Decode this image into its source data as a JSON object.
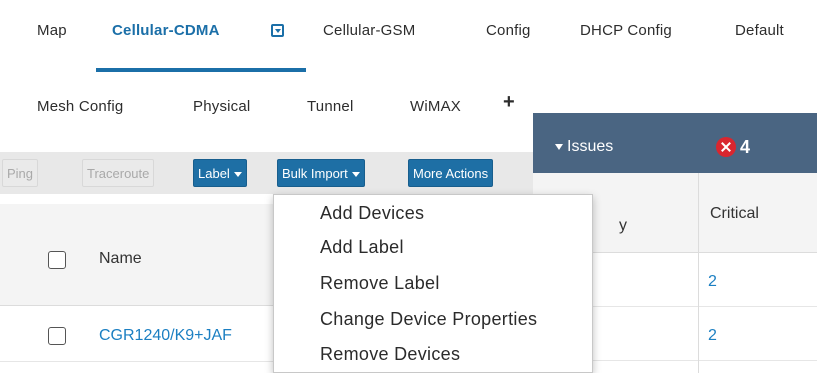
{
  "tabs_row1": [
    "Map",
    "Cellular-CDMA",
    "Cellular-GSM",
    "Config",
    "DHCP Config",
    "Default"
  ],
  "tabs_row2": [
    "Mesh Config",
    "Physical",
    "Tunnel",
    "WiMAX"
  ],
  "active_tab": "Cellular-CDMA",
  "add_tab_icon": "plus-icon",
  "toolbar": {
    "ping": "Ping",
    "traceroute": "Traceroute",
    "label": "Label",
    "bulk_import": "Bulk Import",
    "more_actions": "More Actions"
  },
  "grid": {
    "name_header": "Name",
    "rows": [
      {
        "name": "CGR1240/K9+JAF"
      }
    ]
  },
  "issues": {
    "title": "Issues",
    "count": "4",
    "col_partial": "y",
    "critical_header": "Critical",
    "values": [
      "2",
      "2"
    ]
  },
  "bulk_import_menu": [
    "Add Devices",
    "Add Label",
    "Remove Label",
    "Change Device Properties",
    "Remove Devices"
  ],
  "colors": {
    "accent": "#1b6fa8",
    "button_blue": "#1e6fa5",
    "issues_header": "#4a6582",
    "error_red": "#d9262f",
    "link": "#1b7fc2"
  }
}
